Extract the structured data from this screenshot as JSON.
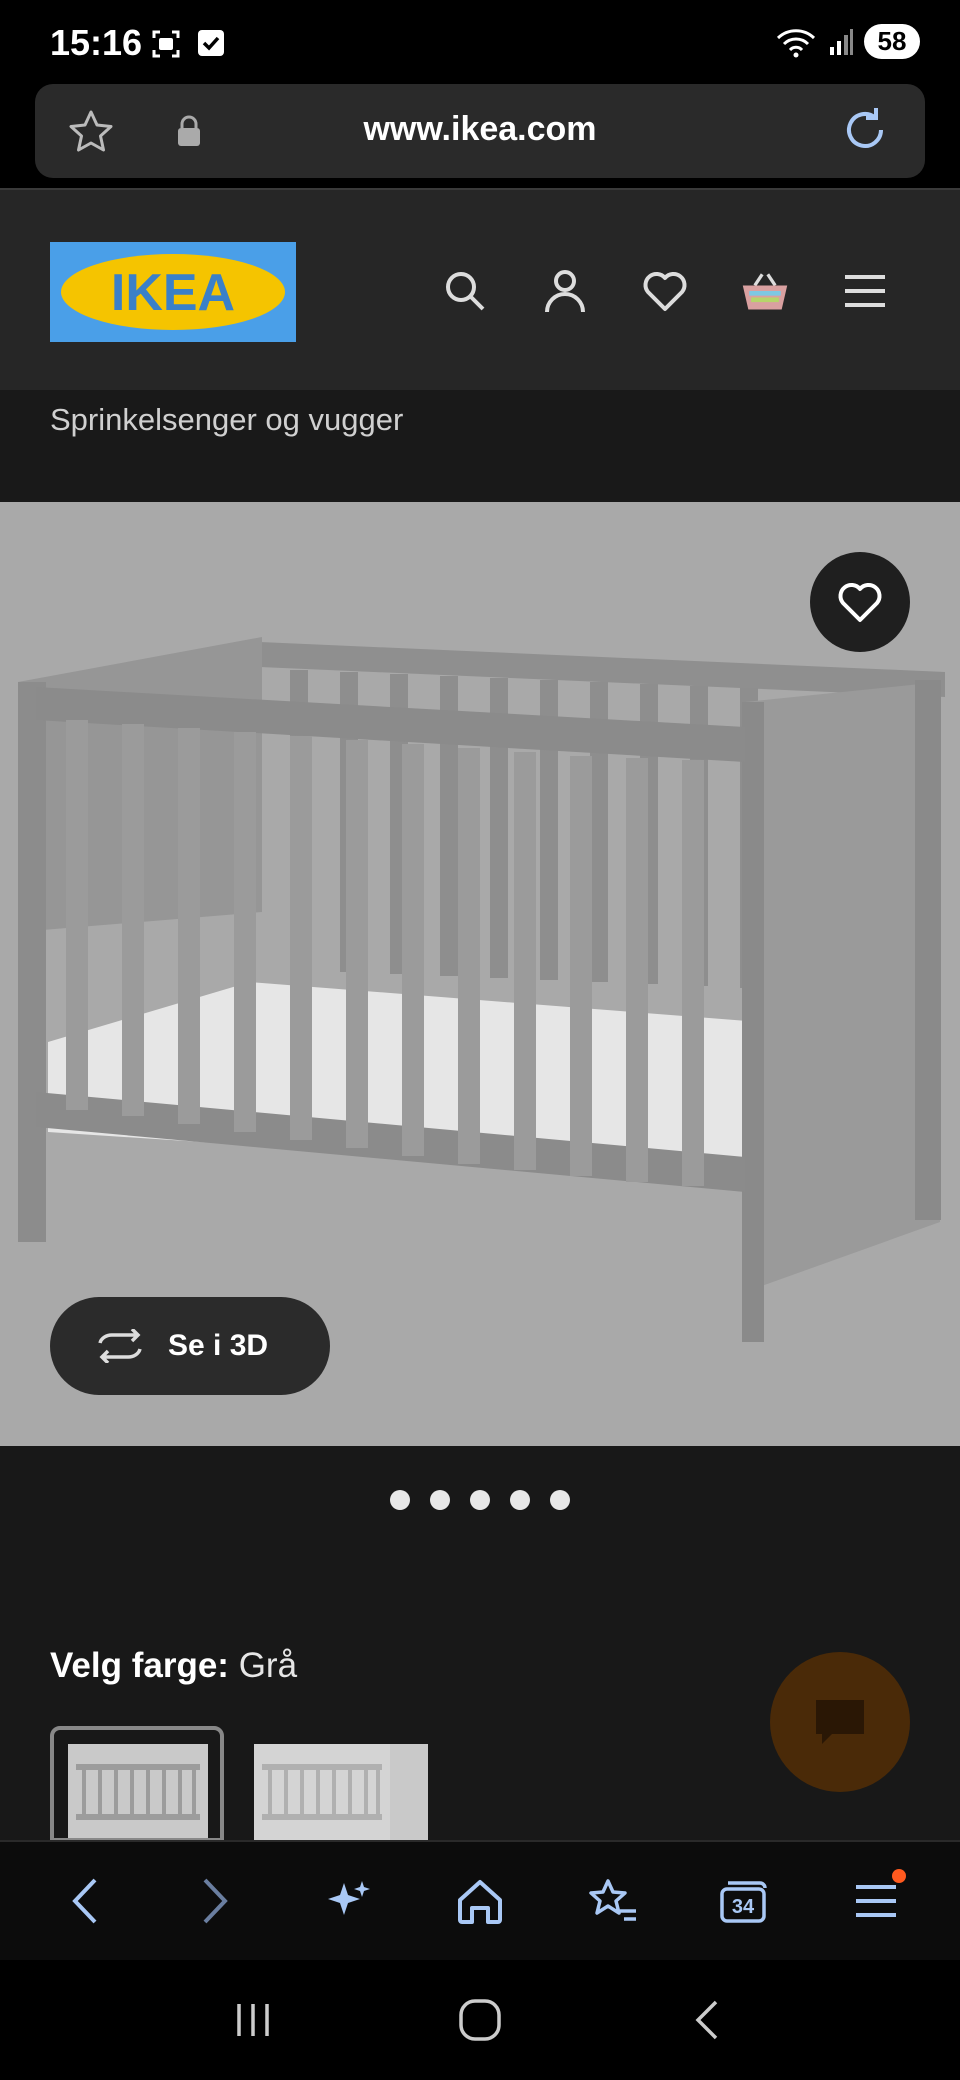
{
  "status_bar": {
    "time": "15:16",
    "battery": "58"
  },
  "url_bar": {
    "url": "www.ikea.com"
  },
  "header": {
    "logo_text": "IKEA"
  },
  "breadcrumb": {
    "label": "Sprinkelsenger og vugger"
  },
  "product": {
    "view_3d_label": "Se i 3D",
    "image_count": 5,
    "active_image": 0
  },
  "color_picker": {
    "label": "Velg farge:",
    "value": "Grå"
  },
  "browser_bar": {
    "tabs_count": "34"
  },
  "colors": {
    "accent": "#f5c400",
    "brand_blue": "#4a9fe8",
    "chat": "#4a2a08",
    "notification": "#ff5a1f"
  }
}
